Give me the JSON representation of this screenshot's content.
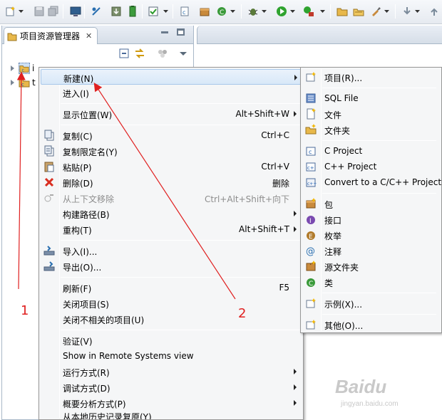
{
  "colors": {
    "annotation": "#e02020",
    "menu_bg": "#f5f6f7",
    "highlight": "#d8e8f8"
  },
  "explorer": {
    "tab_title": "项目资源管理器",
    "close_glyph": "✕",
    "tree": [
      {
        "label": "i",
        "icon": "c-project-icon",
        "selected": true
      },
      {
        "label": "t",
        "icon": "c-project-icon",
        "selected": false
      }
    ]
  },
  "context_menu": {
    "items": [
      {
        "label": "新建(N)",
        "shortcut": "",
        "submenu": true,
        "icon": "",
        "highlighted": true
      },
      {
        "label": "进入(I)",
        "shortcut": "",
        "submenu": false,
        "icon": ""
      },
      {
        "label": "显示位置(W)",
        "shortcut": "Alt+Shift+W",
        "submenu": true,
        "icon": ""
      },
      {
        "label": "复制(C)",
        "shortcut": "Ctrl+C",
        "submenu": false,
        "icon": "copy-icon"
      },
      {
        "label": "复制限定名(Y)",
        "shortcut": "",
        "submenu": false,
        "icon": "copy-qualified-icon"
      },
      {
        "label": "粘贴(P)",
        "shortcut": "Ctrl+V",
        "submenu": false,
        "icon": "paste-icon"
      },
      {
        "label": "删除(D)",
        "shortcut": "删除",
        "submenu": false,
        "icon": "delete-icon"
      },
      {
        "label": "从上下文移除",
        "shortcut": "Ctrl+Alt+Shift+向下",
        "submenu": false,
        "icon": "remove-context-icon",
        "disabled": true
      },
      {
        "label": "构建路径(B)",
        "shortcut": "",
        "submenu": true,
        "icon": ""
      },
      {
        "label": "重构(T)",
        "shortcut": "Alt+Shift+T",
        "submenu": true,
        "icon": ""
      },
      {
        "label": "导入(I)...",
        "shortcut": "",
        "submenu": false,
        "icon": "import-icon"
      },
      {
        "label": "导出(O)...",
        "shortcut": "",
        "submenu": false,
        "icon": "export-icon"
      },
      {
        "label": "刷新(F)",
        "shortcut": "F5",
        "submenu": false,
        "icon": ""
      },
      {
        "label": "关闭项目(S)",
        "shortcut": "",
        "submenu": false,
        "icon": ""
      },
      {
        "label": "关闭不相关的项目(U)",
        "shortcut": "",
        "submenu": false,
        "icon": ""
      },
      {
        "label": "验证(V)",
        "shortcut": "",
        "submenu": false,
        "icon": ""
      },
      {
        "label": "Show in Remote Systems view",
        "shortcut": "",
        "submenu": false,
        "icon": ""
      },
      {
        "label": "运行方式(R)",
        "shortcut": "",
        "submenu": true,
        "icon": ""
      },
      {
        "label": "调试方式(D)",
        "shortcut": "",
        "submenu": true,
        "icon": ""
      },
      {
        "label": "概要分析方式(P)",
        "shortcut": "",
        "submenu": true,
        "icon": ""
      },
      {
        "label": "从本地历史记录复原(Y)",
        "shortcut": "",
        "submenu": false,
        "icon": ""
      }
    ]
  },
  "new_submenu": {
    "items": [
      {
        "label": "项目(R)...",
        "icon": "new-project-icon"
      },
      {
        "label": "SQL File",
        "icon": "sql-file-icon"
      },
      {
        "label": "文件",
        "icon": "new-file-icon"
      },
      {
        "label": "文件夹",
        "icon": "new-folder-icon"
      },
      {
        "label": "C Project",
        "icon": "c-project-icon"
      },
      {
        "label": "C++ Project",
        "icon": "cpp-project-icon"
      },
      {
        "label": "Convert to a C/C++ Project",
        "icon": "convert-project-icon"
      },
      {
        "label": "包",
        "icon": "package-icon"
      },
      {
        "label": "接口",
        "icon": "interface-icon"
      },
      {
        "label": "枚举",
        "icon": "enum-icon"
      },
      {
        "label": "注释",
        "icon": "annotation-icon"
      },
      {
        "label": "源文件夹",
        "icon": "source-folder-icon"
      },
      {
        "label": "类",
        "icon": "class-icon"
      },
      {
        "label": "示例(X)...",
        "icon": "example-icon"
      },
      {
        "label": "其他(O)...",
        "icon": "other-icon"
      }
    ]
  },
  "annotations": {
    "step1": "1",
    "step2": "2"
  },
  "watermark": {
    "logo": "Baidu",
    "sub": "jingyan.baidu.com"
  }
}
